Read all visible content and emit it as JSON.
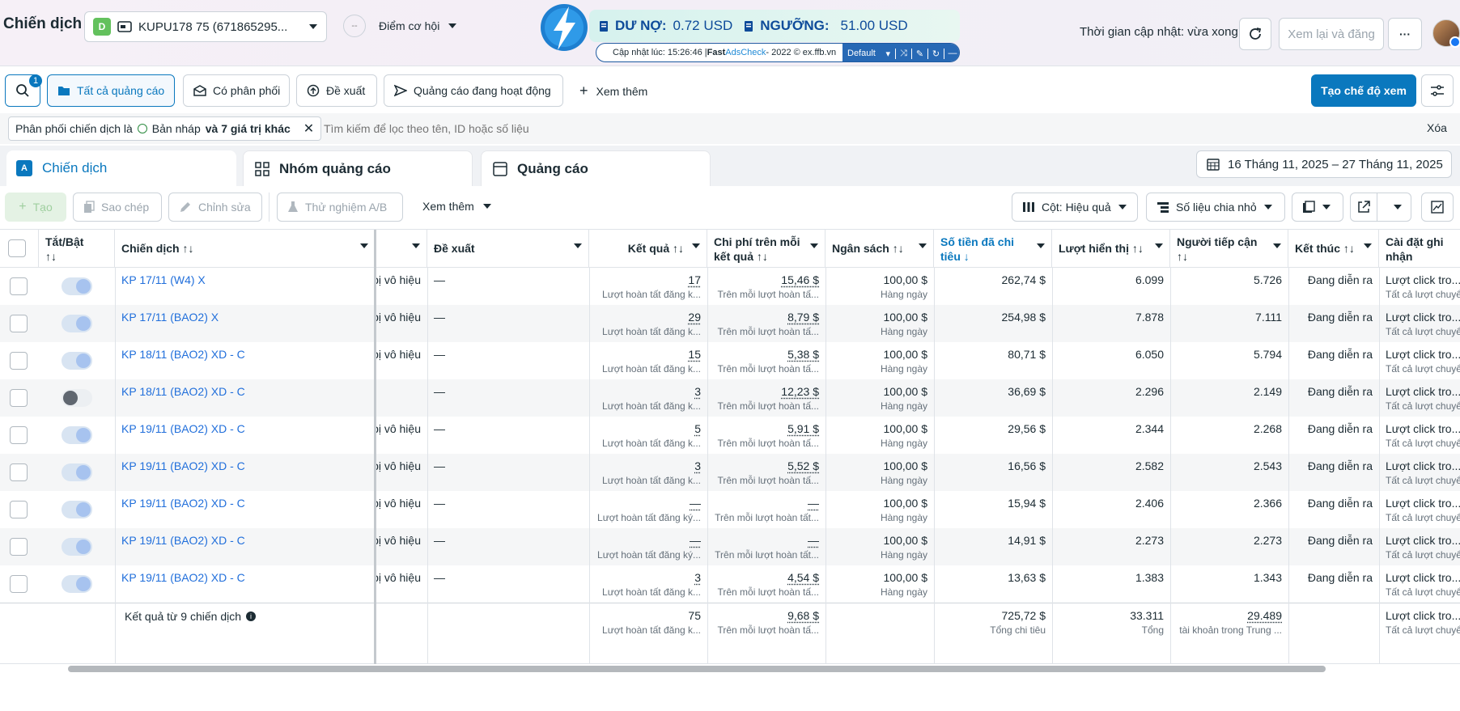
{
  "header": {
    "title": "Chiến dịch",
    "account_badge": "D",
    "account_name": "KUPU178 75 (671865295...",
    "opportunity_label": "Điểm cơ hội",
    "updated_text": "Thời gian cập nhật: vừa xong",
    "review_button": "Xem lại và đăng"
  },
  "adscheck": {
    "debt_label": "DƯ NỢ:",
    "debt_value": "0.72 USD",
    "threshold_label": "NGƯỠNG:",
    "threshold_value": "51.00 USD",
    "update_prefix": "Cập nhật lúc: 15:26:46 | ",
    "brand1": "Fast ",
    "brand2": "AdsCheck",
    "update_suffix": " - 2022 © ex.ffb.vn",
    "profile": "Default"
  },
  "filterbar": {
    "search_badge": "1",
    "tab_all": "Tất cả quảng cáo",
    "tab_delivery": "Có phân phối",
    "tab_recommend": "Đề xuất",
    "tab_active": "Quảng cáo đang hoạt động",
    "more": "Xem thêm",
    "create_view": "Tạo chế độ xem"
  },
  "filter_chip": {
    "prefix": "Phân phối chiến dịch là",
    "value": "Bản nháp",
    "suffix": "và 7 giá trị khác"
  },
  "search": {
    "placeholder": "Tìm kiếm để lọc theo tên, ID hoặc số liệu",
    "clear": "Xóa"
  },
  "level_tabs": {
    "campaigns": "Chiến dịch",
    "adsets": "Nhóm quảng cáo",
    "ads": "Quảng cáo"
  },
  "date_range": "16 Tháng 11, 2025 – 27 Tháng 11, 2025",
  "toolbar": {
    "create": "Tạo",
    "duplicate": "Sao chép",
    "edit": "Chỉnh sửa",
    "ab_test": "Thử nghiệm A/B",
    "more": "Xem thêm",
    "columns": "Cột: Hiệu quả",
    "breakdown": "Số liệu chia nhỏ"
  },
  "columns": {
    "toggle": "Tắt/Bật",
    "toggle_sort": "↑↓",
    "campaign": "Chiến dịch ↑↓",
    "recommend": "Đề xuất",
    "results": "Kết quả ↑↓",
    "cost_per_result": "Chi phí trên mỗi",
    "cost_per_result2": "kết quả ↑↓",
    "budget": "Ngân sách ↑↓",
    "amount_spent": "Số tiền đã chi",
    "amount_spent2": "tiêu ↓",
    "impressions": "Lượt hiển thị ↑↓",
    "reach": "Người tiếp cận",
    "reach2": "↑↓",
    "ends": "Kết thúc ↑↓",
    "attribution": "Cài đặt ghi",
    "attribution2": "nhận"
  },
  "rows": [
    {
      "name": "KP 17/11 (W4) X",
      "on": true,
      "delivery": "bị vô hiệu",
      "rec": "—",
      "results": "17",
      "results_sub": "Lượt hoàn tất đăng k...",
      "cpr": "15,46 $",
      "cpr_sub": "Trên mỗi lượt hoàn tấ...",
      "budget": "100,00 $",
      "budget_sub": "Hàng ngày",
      "spent": "262,74 $",
      "impr": "6.099",
      "reach": "5.726",
      "ends": "Đang diễn ra",
      "attr": "Lượt click tro...",
      "attr_sub": "Tất cả lượt chuyể"
    },
    {
      "name": "KP 17/11 (BAO2) X",
      "on": true,
      "delivery": "bị vô hiệu",
      "rec": "—",
      "results": "29",
      "results_sub": "Lượt hoàn tất đăng k...",
      "cpr": "8,79 $",
      "cpr_sub": "Trên mỗi lượt hoàn tấ...",
      "budget": "100,00 $",
      "budget_sub": "Hàng ngày",
      "spent": "254,98 $",
      "impr": "7.878",
      "reach": "7.111",
      "ends": "Đang diễn ra",
      "attr": "Lượt click tro...",
      "attr_sub": "Tất cả lượt chuyể"
    },
    {
      "name": "KP 18/11 (BAO2) XD - C",
      "on": true,
      "delivery": "bị vô hiệu",
      "rec": "—",
      "results": "15",
      "results_sub": "Lượt hoàn tất đăng k...",
      "cpr": "5,38 $",
      "cpr_sub": "Trên mỗi lượt hoàn tấ...",
      "budget": "100,00 $",
      "budget_sub": "Hàng ngày",
      "spent": "80,71 $",
      "impr": "6.050",
      "reach": "5.794",
      "ends": "Đang diễn ra",
      "attr": "Lượt click tro...",
      "attr_sub": "Tất cả lượt chuyể"
    },
    {
      "name": "KP 18/11 (BAO2) XD - C",
      "on": false,
      "delivery": "",
      "rec": "—",
      "results": "3",
      "results_sub": "Lượt hoàn tất đăng k...",
      "cpr": "12,23 $",
      "cpr_sub": "Trên mỗi lượt hoàn tấ...",
      "budget": "100,00 $",
      "budget_sub": "Hàng ngày",
      "spent": "36,69 $",
      "impr": "2.296",
      "reach": "2.149",
      "ends": "Đang diễn ra",
      "attr": "Lượt click tro...",
      "attr_sub": "Tất cả lượt chuyể"
    },
    {
      "name": "KP 19/11 (BAO2) XD - C",
      "on": true,
      "delivery": "bị vô hiệu",
      "rec": "—",
      "results": "5",
      "results_sub": "Lượt hoàn tất đăng k...",
      "cpr": "5,91 $",
      "cpr_sub": "Trên mỗi lượt hoàn tấ...",
      "budget": "100,00 $",
      "budget_sub": "Hàng ngày",
      "spent": "29,56 $",
      "impr": "2.344",
      "reach": "2.268",
      "ends": "Đang diễn ra",
      "attr": "Lượt click tro...",
      "attr_sub": "Tất cả lượt chuyể"
    },
    {
      "name": "KP 19/11 (BAO2) XD - C",
      "on": true,
      "delivery": "bị vô hiệu",
      "rec": "—",
      "results": "3",
      "results_sub": "Lượt hoàn tất đăng k...",
      "cpr": "5,52 $",
      "cpr_sub": "Trên mỗi lượt hoàn tấ...",
      "budget": "100,00 $",
      "budget_sub": "Hàng ngày",
      "spent": "16,56 $",
      "impr": "2.582",
      "reach": "2.543",
      "ends": "Đang diễn ra",
      "attr": "Lượt click tro...",
      "attr_sub": "Tất cả lượt chuyể"
    },
    {
      "name": "KP 19/11 (BAO2) XD - C",
      "on": true,
      "delivery": "bị vô hiệu",
      "rec": "—",
      "results": "—",
      "results_sub": "Lượt hoàn tất đăng ký...",
      "cpr": "—",
      "cpr_sub": "Trên mỗi lượt hoàn tất...",
      "budget": "100,00 $",
      "budget_sub": "Hàng ngày",
      "spent": "15,94 $",
      "impr": "2.406",
      "reach": "2.366",
      "ends": "Đang diễn ra",
      "attr": "Lượt click tro...",
      "attr_sub": "Tất cả lượt chuyể"
    },
    {
      "name": "KP 19/11 (BAO2) XD - C",
      "on": true,
      "delivery": "bị vô hiệu",
      "rec": "—",
      "results": "—",
      "results_sub": "Lượt hoàn tất đăng ký...",
      "cpr": "—",
      "cpr_sub": "Trên mỗi lượt hoàn tất...",
      "budget": "100,00 $",
      "budget_sub": "Hàng ngày",
      "spent": "14,91 $",
      "impr": "2.273",
      "reach": "2.273",
      "ends": "Đang diễn ra",
      "attr": "Lượt click tro...",
      "attr_sub": "Tất cả lượt chuyể"
    },
    {
      "name": "KP 19/11 (BAO2) XD - C",
      "on": true,
      "delivery": "bị vô hiệu",
      "rec": "—",
      "results": "3",
      "results_sub": "Lượt hoàn tất đăng k...",
      "cpr": "4,54 $",
      "cpr_sub": "Trên mỗi lượt hoàn tấ...",
      "budget": "100,00 $",
      "budget_sub": "Hàng ngày",
      "spent": "13,63 $",
      "impr": "1.383",
      "reach": "1.343",
      "ends": "Đang diễn ra",
      "attr": "Lượt click tro...",
      "attr_sub": "Tất cả lượt chuyể"
    }
  ],
  "summary": {
    "label": "Kết quả từ 9 chiến dịch",
    "results": "75",
    "results_sub": "Lượt hoàn tất đăng k...",
    "cpr": "9,68 $",
    "cpr_sub": "Trên mỗi lượt hoàn tấ...",
    "spent": "725,72 $",
    "spent_sub": "Tổng chi tiêu",
    "impr": "33.311",
    "impr_sub": "Tổng",
    "reach": "29.489",
    "reach_sub": "tài khoản trong Trung ...",
    "attr": "Lượt click tro...",
    "attr_sub": "Tất cả lượt chuyể"
  }
}
